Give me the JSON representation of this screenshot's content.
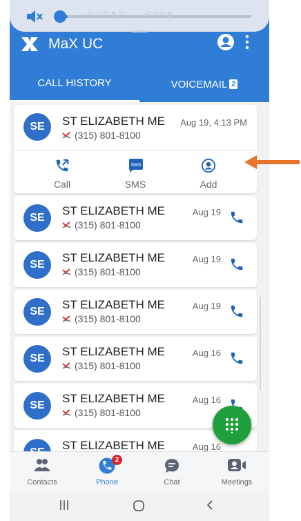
{
  "app": {
    "title": "MaX UC"
  },
  "tabs": [
    {
      "label": "CALL HISTORY"
    },
    {
      "label": "VOICEMAIL",
      "badge": "2"
    }
  ],
  "volume": {
    "level_percent": 5,
    "status_text": "◎ ⌖ ✆ ▮ ⊡ · · · ◂ⁱˡˡ ⁹⁵%▮"
  },
  "expanded_entry": {
    "initials": "SE",
    "name": "ST ELIZABETH ME",
    "phone": "(315) 801-8100",
    "date": "Aug 19, 4:13 PM",
    "actions": [
      {
        "label": "Call",
        "icon": "call-back-icon"
      },
      {
        "label": "SMS",
        "icon": "sms-icon"
      },
      {
        "label": "Add",
        "icon": "add-contact-icon"
      }
    ]
  },
  "entries": [
    {
      "initials": "SE",
      "name": "ST ELIZABETH ME",
      "phone": "(315) 801-8100",
      "date": "Aug 19"
    },
    {
      "initials": "SE",
      "name": "ST ELIZABETH ME",
      "phone": "(315) 801-8100",
      "date": "Aug 19"
    },
    {
      "initials": "SE",
      "name": "ST ELIZABETH ME",
      "phone": "(315) 801-8100",
      "date": "Aug 19"
    },
    {
      "initials": "SE",
      "name": "ST ELIZABETH ME",
      "phone": "(315) 801-8100",
      "date": "Aug 16"
    },
    {
      "initials": "SE",
      "name": "ST ELIZABETH ME",
      "phone": "(315) 801-8100",
      "date": "Aug 16"
    },
    {
      "initials": "SE",
      "name": "ST ELIZABETH ME",
      "phone": "",
      "date": "Aug 16"
    }
  ],
  "bottom_nav": [
    {
      "label": "Contacts",
      "icon": "contacts-icon"
    },
    {
      "label": "Phone",
      "icon": "phone-icon",
      "badge": "2",
      "active": true
    },
    {
      "label": "Chat",
      "icon": "chat-icon"
    },
    {
      "label": "Meetings",
      "icon": "meetings-icon"
    }
  ],
  "system_nav": [
    "recents-icon",
    "home-icon",
    "back-icon"
  ],
  "colors": {
    "brand_blue": "#2f7dd6",
    "fab_green": "#1f9e3c",
    "badge_red": "#d7262b",
    "annotation_orange": "#e8732a"
  }
}
